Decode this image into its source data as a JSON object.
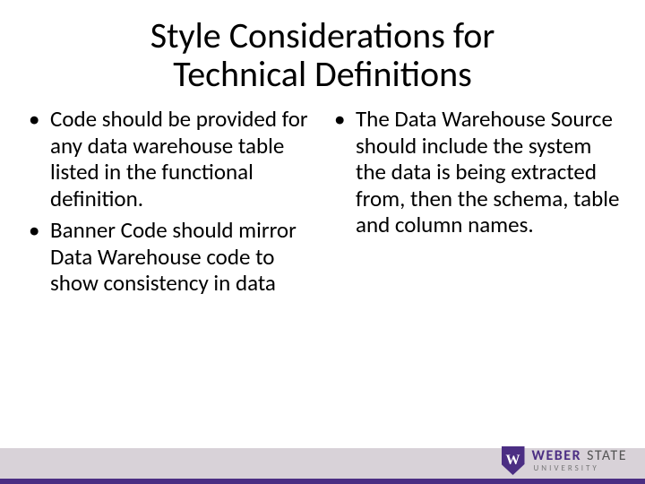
{
  "title_line1": "Style Considerations for",
  "title_line2": "Technical Definitions",
  "left_bullets": [
    "Code should be provided for any data warehouse table listed in the functional definition.",
    "Banner Code should mirror Data Warehouse code to show consistency in data"
  ],
  "right_bullets": [
    "The Data Warehouse Source should include the system the data is being extracted from, then the schema, table and column names."
  ],
  "logo": {
    "shield_letter": "W",
    "word1": "WEBER",
    "word2": "STATE",
    "word3": "UNIVERSITY"
  },
  "colors": {
    "brand_purple": "#4b2e83",
    "footer_bg": "#d8d2d8"
  }
}
